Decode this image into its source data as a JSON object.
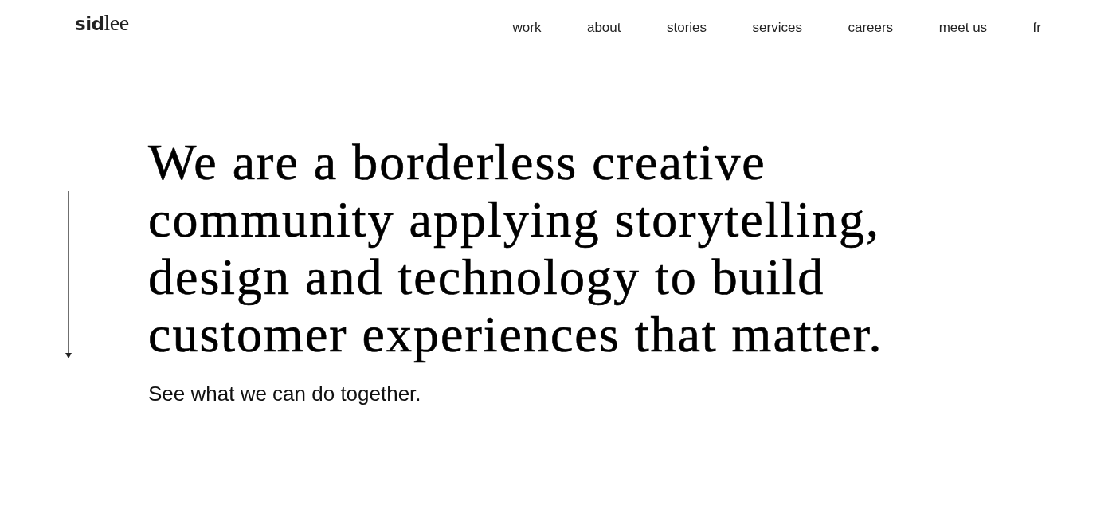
{
  "header": {
    "logo": "**sid**lee",
    "nav": [
      {
        "label": "work"
      },
      {
        "label": "about"
      },
      {
        "label": "stories"
      },
      {
        "label": "services"
      },
      {
        "label": "careers"
      },
      {
        "label": "meet us"
      },
      {
        "label": "fr"
      }
    ]
  },
  "hero": {
    "headline": "We are a borderless creative community applying storytelling, design and technology to build customer experiences that matter.",
    "subtitle": "See what we can do together."
  }
}
